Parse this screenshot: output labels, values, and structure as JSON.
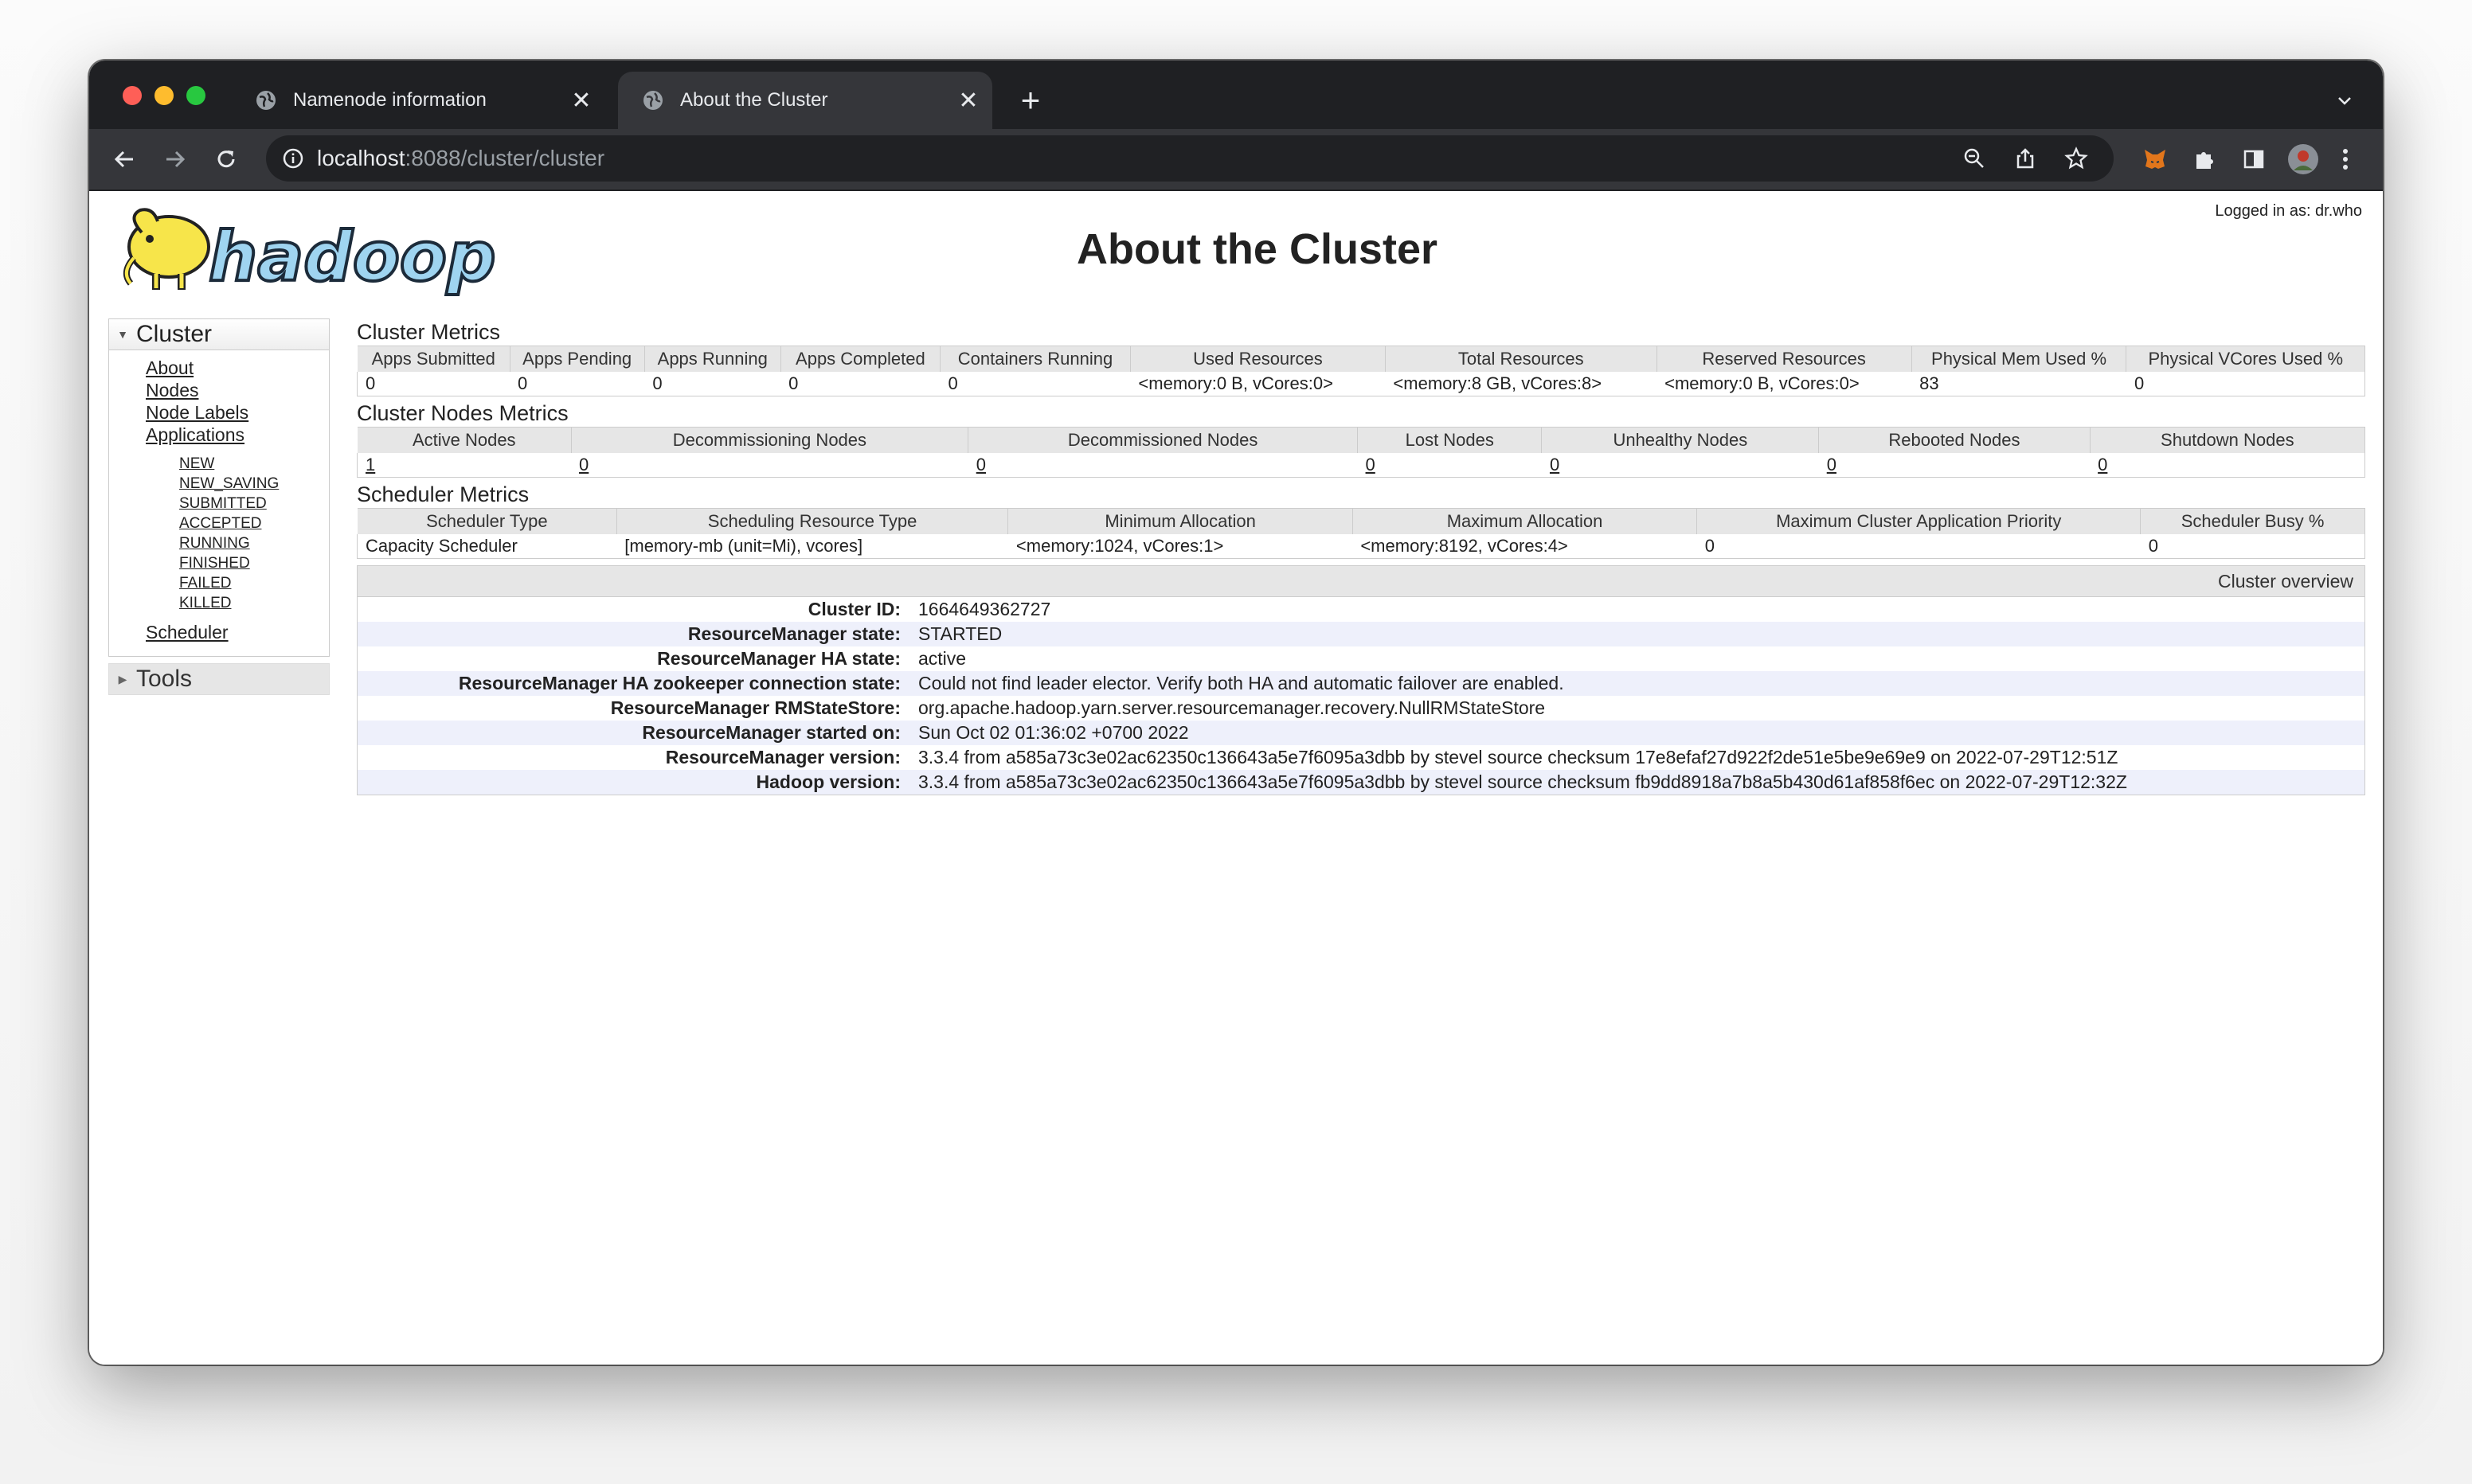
{
  "browser": {
    "tabs": [
      {
        "title": "Namenode information",
        "active": false
      },
      {
        "title": "About the Cluster",
        "active": true
      }
    ],
    "url_host": "localhost",
    "url_path": ":8088/cluster/cluster"
  },
  "header": {
    "logged_in": "Logged in as: dr.who",
    "page_title": "About the Cluster",
    "logo_text": "hadoop"
  },
  "sidebar": {
    "cluster_label": "Cluster",
    "links": [
      "About",
      "Nodes",
      "Node Labels",
      "Applications"
    ],
    "app_states": [
      "NEW",
      "NEW_SAVING",
      "SUBMITTED",
      "ACCEPTED",
      "RUNNING",
      "FINISHED",
      "FAILED",
      "KILLED"
    ],
    "scheduler": "Scheduler",
    "tools_label": "Tools"
  },
  "cluster_metrics": {
    "title": "Cluster Metrics",
    "headers": [
      "Apps Submitted",
      "Apps Pending",
      "Apps Running",
      "Apps Completed",
      "Containers Running",
      "Used Resources",
      "Total Resources",
      "Reserved Resources",
      "Physical Mem Used %",
      "Physical VCores Used %"
    ],
    "values": [
      "0",
      "0",
      "0",
      "0",
      "0",
      "<memory:0 B, vCores:0>",
      "<memory:8 GB, vCores:8>",
      "<memory:0 B, vCores:0>",
      "83",
      "0"
    ]
  },
  "node_metrics": {
    "title": "Cluster Nodes Metrics",
    "headers": [
      "Active Nodes",
      "Decommissioning Nodes",
      "Decommissioned Nodes",
      "Lost Nodes",
      "Unhealthy Nodes",
      "Rebooted Nodes",
      "Shutdown Nodes"
    ],
    "values": [
      "1",
      "0",
      "0",
      "0",
      "0",
      "0",
      "0"
    ]
  },
  "scheduler_metrics": {
    "title": "Scheduler Metrics",
    "headers": [
      "Scheduler Type",
      "Scheduling Resource Type",
      "Minimum Allocation",
      "Maximum Allocation",
      "Maximum Cluster Application Priority",
      "Scheduler Busy %"
    ],
    "values": [
      "Capacity Scheduler",
      "[memory-mb (unit=Mi), vcores]",
      "<memory:1024, vCores:1>",
      "<memory:8192, vCores:4>",
      "0",
      "0"
    ]
  },
  "overview": {
    "heading": "Cluster overview",
    "rows": [
      {
        "key": "Cluster ID:",
        "value": "1664649362727"
      },
      {
        "key": "ResourceManager state:",
        "value": "STARTED"
      },
      {
        "key": "ResourceManager HA state:",
        "value": "active"
      },
      {
        "key": "ResourceManager HA zookeeper connection state:",
        "value": "Could not find leader elector. Verify both HA and automatic failover are enabled."
      },
      {
        "key": "ResourceManager RMStateStore:",
        "value": "org.apache.hadoop.yarn.server.resourcemanager.recovery.NullRMStateStore"
      },
      {
        "key": "ResourceManager started on:",
        "value": "Sun Oct 02 01:36:02 +0700 2022"
      },
      {
        "key": "ResourceManager version:",
        "value": "3.3.4 from a585a73c3e02ac62350c136643a5e7f6095a3dbb by stevel source checksum 17e8efaf27d922f2de51e5be9e69e9 on 2022-07-29T12:51Z"
      },
      {
        "key": "Hadoop version:",
        "value": "3.3.4 from a585a73c3e02ac62350c136643a5e7f6095a3dbb by stevel source checksum fb9dd8918a7b8a5b430d61af858f6ec on 2022-07-29T12:32Z"
      }
    ]
  }
}
